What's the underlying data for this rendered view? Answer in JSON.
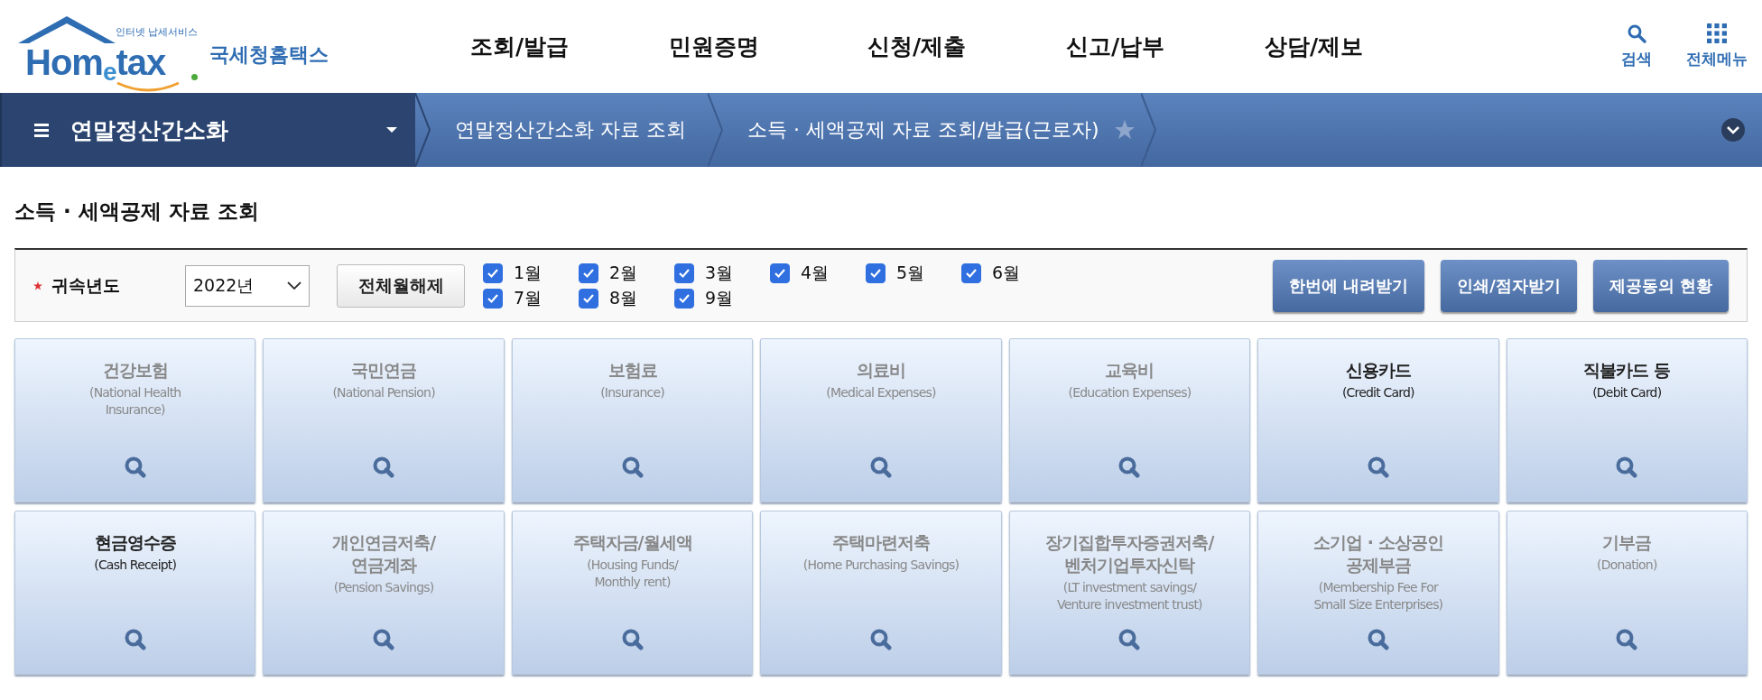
{
  "logo": {
    "tagline": "인터넷 납세서비스",
    "wordmark": [
      "Hom",
      "e",
      "tax"
    ],
    "name": "국세청홈택스"
  },
  "nav": [
    "조회/발급",
    "민원증명",
    "신청/제출",
    "신고/납부",
    "상담/제보"
  ],
  "utilities": [
    {
      "kind": "search",
      "label": "검색"
    },
    {
      "kind": "grid",
      "label": "전체메뉴"
    }
  ],
  "breadcrumb": {
    "menu": "연말정산간소화",
    "steps": [
      {
        "label": "연말정산간소화 자료 조회",
        "favorite": false
      },
      {
        "label": "소득 · 세액공제 자료 조회/발급(근로자)",
        "favorite": true
      }
    ]
  },
  "page_title": "소득 · 세액공제 자료 조회",
  "filter": {
    "required_label": "귀속년도",
    "year": "2022년",
    "clear_button": "전체월해제",
    "months": [
      {
        "label": "1월",
        "checked": true
      },
      {
        "label": "2월",
        "checked": true
      },
      {
        "label": "3월",
        "checked": true
      },
      {
        "label": "4월",
        "checked": true
      },
      {
        "label": "5월",
        "checked": true
      },
      {
        "label": "6월",
        "checked": true
      },
      {
        "label": "7월",
        "checked": true
      },
      {
        "label": "8월",
        "checked": true
      },
      {
        "label": "9월",
        "checked": true
      }
    ],
    "buttons": [
      "한번에 내려받기",
      "인쇄/점자받기",
      "제공동의 현황"
    ]
  },
  "tiles": [
    {
      "title": [
        "건강보험"
      ],
      "subtitle": [
        "(National Health",
        "Insurance)"
      ],
      "active": false
    },
    {
      "title": [
        "국민연금"
      ],
      "subtitle": [
        "(National Pension)"
      ],
      "active": false
    },
    {
      "title": [
        "보험료"
      ],
      "subtitle": [
        "(Insurance)"
      ],
      "active": false
    },
    {
      "title": [
        "의료비"
      ],
      "subtitle": [
        "(Medical Expenses)"
      ],
      "active": false
    },
    {
      "title": [
        "교육비"
      ],
      "subtitle": [
        "(Education Expenses)"
      ],
      "active": false
    },
    {
      "title": [
        "신용카드"
      ],
      "subtitle": [
        "(Credit Card)"
      ],
      "active": true
    },
    {
      "title": [
        "직불카드 등"
      ],
      "subtitle": [
        "(Debit Card)"
      ],
      "active": true
    },
    {
      "title": [
        "현금영수증"
      ],
      "subtitle": [
        "(Cash Receipt)"
      ],
      "active": true
    },
    {
      "title": [
        "개인연금저축/",
        "연금계좌"
      ],
      "subtitle": [
        "(Pension Savings)"
      ],
      "active": false
    },
    {
      "title": [
        "주택자금/월세액"
      ],
      "subtitle": [
        "(Housing Funds/",
        "Monthly rent)"
      ],
      "active": false
    },
    {
      "title": [
        "주택마련저축"
      ],
      "subtitle": [
        "(Home Purchasing Savings)"
      ],
      "active": false
    },
    {
      "title": [
        "장기집합투자증권저축/",
        "벤처기업투자신탁"
      ],
      "subtitle": [
        "(LT investment savings/",
        "Venture investment trust)"
      ],
      "active": false
    },
    {
      "title": [
        "소기업 · 소상공인",
        "공제부금"
      ],
      "subtitle": [
        "(Membership Fee For",
        "Small Size Enterprises)"
      ],
      "active": false
    },
    {
      "title": [
        "기부금"
      ],
      "subtitle": [
        "(Donation)"
      ],
      "active": false
    }
  ]
}
